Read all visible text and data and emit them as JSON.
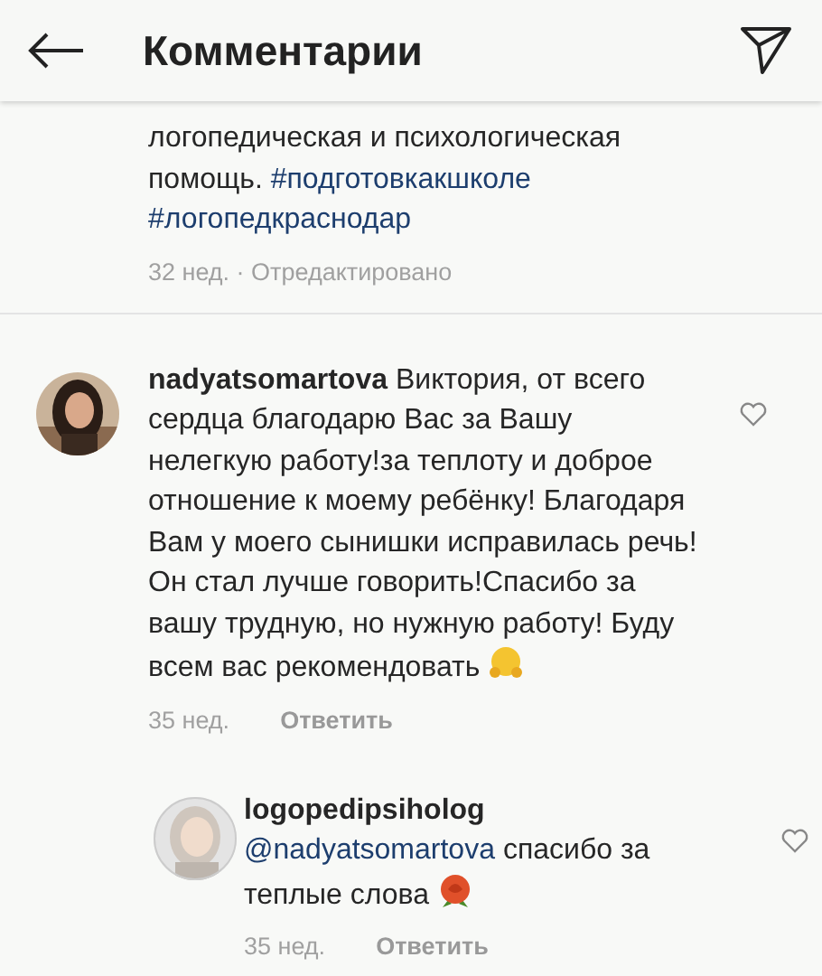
{
  "header": {
    "title": "Комментарии"
  },
  "caption": {
    "parts": [
      {
        "kind": "text",
        "text": "логопедическая и психологическая помощь.  "
      },
      {
        "kind": "hashtag",
        "text": "#подготовкакшколе"
      },
      {
        "kind": "hashtag",
        "text": "#логопедкраснодар"
      }
    ],
    "time": "32 нед. · Отредактировано"
  },
  "comments": [
    {
      "username": "nadyatsomartova",
      "parts": [
        {
          "kind": "text",
          "text": "Виктория, от всего сердца благодарю Вас за Вашу нелегкую работу!за теплоту и доброе отношение к моему ребёнку! Благодаря Вам у моего сынишки исправилась речь! Он стал лучше говорить!Спасибо за вашу трудную, но нужную работу! Буду всем вас рекомендовать "
        },
        {
          "kind": "emoji-hug"
        }
      ],
      "time": "35 нед.",
      "reply": "Ответить",
      "liked": false,
      "replies": [
        {
          "username": "logopedipsiholog",
          "parts": [
            {
              "kind": "mention",
              "text": "@nadyatsomartova"
            },
            {
              "kind": "text",
              "text": " спасибо за теплые слова "
            },
            {
              "kind": "emoji-rose"
            }
          ],
          "time": "35 нед.",
          "reply": "Ответить",
          "liked": false
        }
      ]
    }
  ]
}
